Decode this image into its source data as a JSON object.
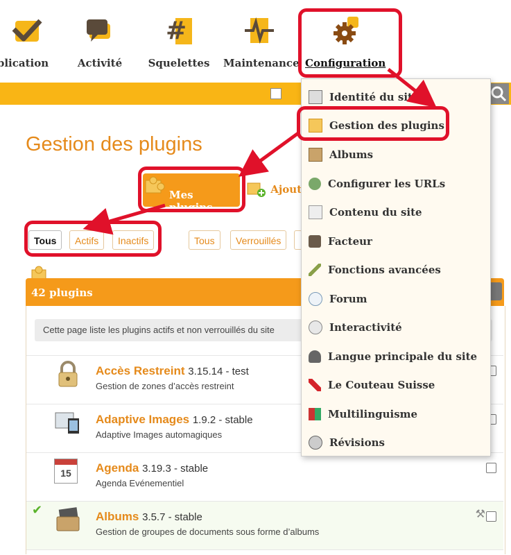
{
  "nav": {
    "items": [
      {
        "label": "blication",
        "icon": "check-icon"
      },
      {
        "label": "Activité",
        "icon": "speech-bubble-icon"
      },
      {
        "label": "Squelettes",
        "icon": "hash-icon"
      },
      {
        "label": "Maintenance",
        "icon": "pulse-icon"
      },
      {
        "label": "Configuration",
        "icon": "gear-icon"
      }
    ]
  },
  "page": {
    "title": "Gestion des plugins"
  },
  "tabs": {
    "main": "Mes plugins",
    "add": "Ajout"
  },
  "filters": {
    "status": [
      "Tous",
      "Actifs",
      "Inactifs"
    ],
    "lock": [
      "Tous",
      "Verrouillés"
    ]
  },
  "panel": {
    "count": "42 plugins",
    "info": "Cette page liste les plugins actifs et non verrouillés du site"
  },
  "plugins": [
    {
      "name": "Accès Restreint",
      "version": "3.15.14 - test",
      "desc": "Gestion de zones d’accès restreint",
      "active": false
    },
    {
      "name": "Adaptive Images",
      "version": "1.9.2 - stable",
      "desc": "Adaptive Images automagiques",
      "active": false
    },
    {
      "name": "Agenda",
      "version": "3.19.3 - stable",
      "desc": "Agenda Evénementiel",
      "active": false,
      "cal": "15"
    },
    {
      "name": "Albums",
      "version": "3.5.7 - stable",
      "desc": "Gestion de groupes de documents sous forme d’albums",
      "active": true
    }
  ],
  "menu": [
    "Identité du site",
    "Gestion des plugins",
    "Albums",
    "Configurer les URLs",
    "Contenu du site",
    "Facteur",
    "Fonctions avancées",
    "Forum",
    "Interactivité",
    "Langue principale du site",
    "Le Couteau Suisse",
    "Multilinguisme",
    "Révisions"
  ],
  "colors": {
    "accent": "#f59a1a",
    "bar": "#f9b515",
    "annotation": "#e0112a",
    "title": "#e58a1b"
  }
}
